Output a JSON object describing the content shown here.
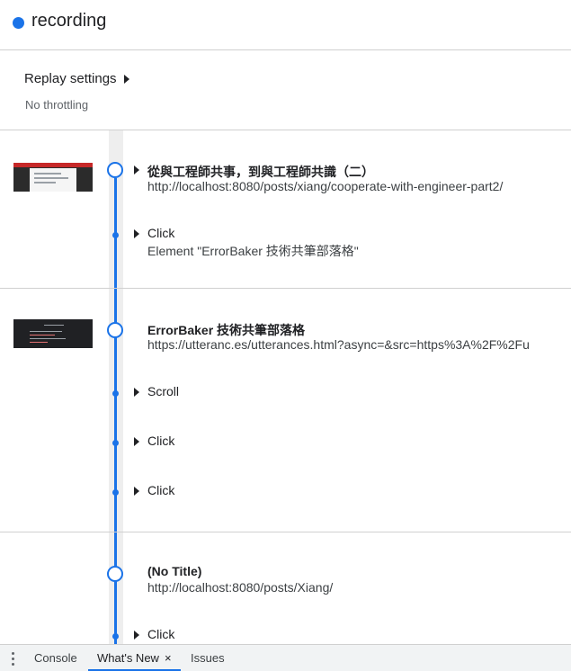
{
  "header": {
    "title": "recording",
    "status_color": "#1a73e8"
  },
  "replay_settings": {
    "label": "Replay settings",
    "value": "No throttling"
  },
  "sections": [
    {
      "steps": [
        {
          "title": "從與工程師共事，到與工程師共識（二）",
          "subtitle": "http://localhost:8080/posts/xiang/cooperate-with-engineer-part2/"
        },
        {
          "title": "Click",
          "subtitle": "Element \"ErrorBaker 技術共筆部落格\""
        }
      ]
    },
    {
      "steps": [
        {
          "title": "ErrorBaker 技術共筆部落格",
          "subtitle": "https://utteranc.es/utterances.html?async=&src=https%3A%2F%2Fu"
        },
        {
          "title": "Scroll"
        },
        {
          "title": "Click"
        },
        {
          "title": "Click"
        }
      ]
    },
    {
      "steps": [
        {
          "title": "(No Title)",
          "subtitle": "http://localhost:8080/posts/Xiang/"
        },
        {
          "title": "Click"
        }
      ]
    }
  ],
  "drawer": {
    "tabs": [
      {
        "label": "Console"
      },
      {
        "label": "What's New",
        "active": true,
        "close": "×"
      },
      {
        "label": "Issues"
      }
    ]
  },
  "icons": {
    "menu": "more-vert-icon",
    "expand": "triangle-right-icon",
    "close": "close-icon"
  },
  "colors": {
    "accent": "#1a73e8",
    "track": "#eeeeee"
  }
}
